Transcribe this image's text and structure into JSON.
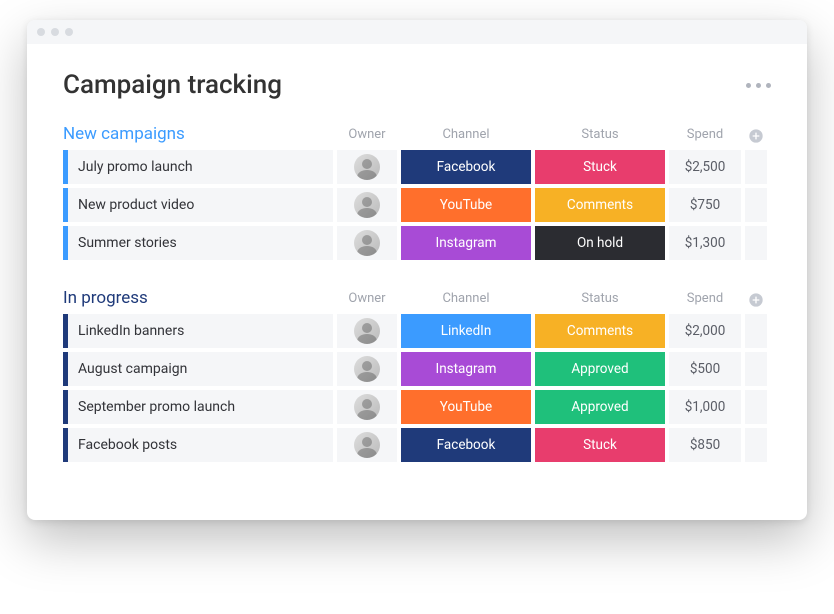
{
  "page": {
    "title": "Campaign tracking"
  },
  "columns": {
    "owner": "Owner",
    "channel": "Channel",
    "status": "Status",
    "spend": "Spend"
  },
  "colors": {
    "facebook": "#1f3a7a",
    "youtube": "#ff6f2c",
    "instagram": "#a84bd6",
    "linkedin": "#3b9bff",
    "stuck": "#e83d6d",
    "comments": "#f7b125",
    "onhold": "#2b2c31",
    "approved": "#1fc07b",
    "group_new": "#3b9bff",
    "group_progress": "#1f3a7a"
  },
  "groups": [
    {
      "id": "new",
      "title": "New campaigns",
      "color_key": "group_new",
      "rows": [
        {
          "name": "July promo launch",
          "owner": "a1",
          "channel": "Facebook",
          "channel_color_key": "facebook",
          "status": "Stuck",
          "status_color_key": "stuck",
          "spend": "$2,500"
        },
        {
          "name": "New product video",
          "owner": "a2",
          "channel": "YouTube",
          "channel_color_key": "youtube",
          "status": "Comments",
          "status_color_key": "comments",
          "spend": "$750"
        },
        {
          "name": "Summer stories",
          "owner": "a3",
          "channel": "Instagram",
          "channel_color_key": "instagram",
          "status": "On hold",
          "status_color_key": "onhold",
          "spend": "$1,300"
        }
      ]
    },
    {
      "id": "progress",
      "title": "In progress",
      "color_key": "group_progress",
      "rows": [
        {
          "name": "LinkedIn banners",
          "owner": "a4",
          "channel": "LinkedIn",
          "channel_color_key": "linkedin",
          "status": "Comments",
          "status_color_key": "comments",
          "spend": "$2,000"
        },
        {
          "name": "August campaign",
          "owner": "a5",
          "channel": "Instagram",
          "channel_color_key": "instagram",
          "status": "Approved",
          "status_color_key": "approved",
          "spend": "$500"
        },
        {
          "name": "September promo launch",
          "owner": "a6",
          "channel": "YouTube",
          "channel_color_key": "youtube",
          "status": "Approved",
          "status_color_key": "approved",
          "spend": "$1,000"
        },
        {
          "name": "Facebook posts",
          "owner": "a7",
          "channel": "Facebook",
          "channel_color_key": "facebook",
          "status": "Stuck",
          "status_color_key": "stuck",
          "spend": "$850"
        }
      ]
    }
  ]
}
